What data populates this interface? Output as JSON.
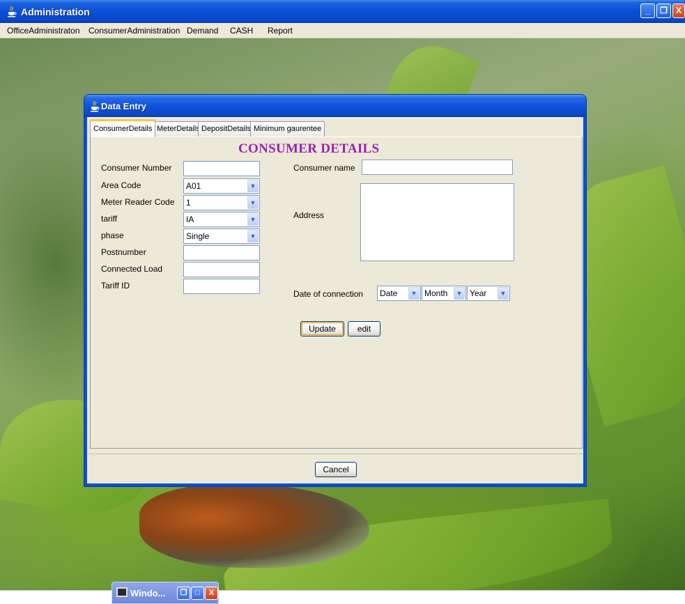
{
  "main_window": {
    "title": "Administration",
    "controls": {
      "minimize": "_",
      "maximize": "❐",
      "close": "X"
    }
  },
  "menubar": {
    "items": [
      "OfficeAdministraton",
      "ConsumerAdministration",
      "Demand",
      "CASH",
      "Report"
    ]
  },
  "dialog": {
    "title": "Data Entry",
    "tabs": [
      "ConsumerDetails",
      "MeterDetails",
      "DepositDetails",
      "Minimum gaurentee"
    ],
    "active_tab": "ConsumerDetails",
    "section_title": "CONSUMER DETAILS",
    "fields": {
      "consumer_number": {
        "label": "Consumer Number",
        "value": ""
      },
      "area_code": {
        "label": "Area Code",
        "value": "A01"
      },
      "meter_reader_code": {
        "label": "Meter Reader Code",
        "value": "1"
      },
      "tariff": {
        "label": "tariff",
        "value": "IA"
      },
      "phase": {
        "label": "phase",
        "value": "Single"
      },
      "postnumber": {
        "label": "Postnumber",
        "value": ""
      },
      "connected_load": {
        "label": "Connected Load",
        "value": ""
      },
      "tariff_id": {
        "label": "Tariff ID",
        "value": ""
      },
      "consumer_name": {
        "label": "Consumer name",
        "value": ""
      },
      "address": {
        "label": "Address",
        "value": ""
      },
      "date_of_connection": {
        "label": "Date of connection",
        "date": "Date",
        "month": "Month",
        "year": "Year"
      }
    },
    "buttons": {
      "update": "Update",
      "edit": "edit",
      "cancel": "Cancel"
    }
  },
  "minimized_frame": {
    "title": "Windo...",
    "controls": {
      "restore": "❐",
      "maximize": "□",
      "close": "X"
    }
  },
  "colors": {
    "titlebar_blue": "#0a4fd6",
    "section_title": "#9a1fb0",
    "panel_bg": "#ece9d8",
    "active_tab_accent": "#ffc83c"
  }
}
